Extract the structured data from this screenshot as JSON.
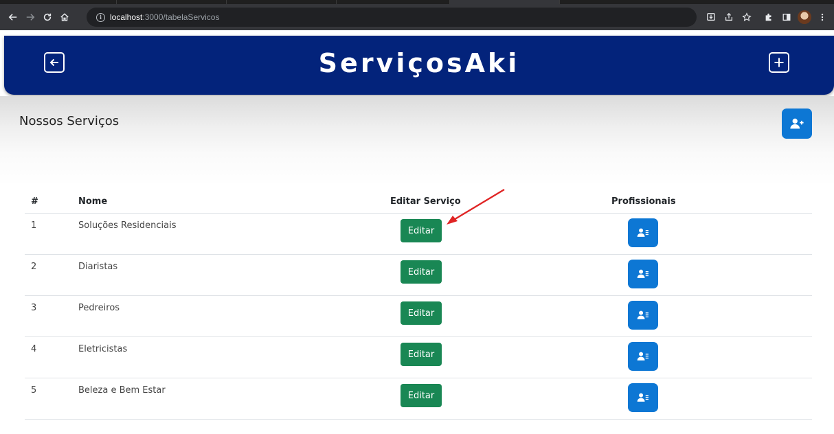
{
  "browser": {
    "url_host": "localhost",
    "url_path": ":3000/tabelaServicos",
    "info_glyph": "i"
  },
  "header": {
    "brand": "ServiçosAki"
  },
  "section": {
    "title": "Nossos Serviços"
  },
  "table": {
    "headers": {
      "num": "#",
      "name": "Nome",
      "edit": "Editar Serviço",
      "professionals": "Profissionais"
    },
    "rows": [
      {
        "num": "1",
        "name": "Soluções Residenciais",
        "edit_label": "Editar"
      },
      {
        "num": "2",
        "name": "Diaristas",
        "edit_label": "Editar"
      },
      {
        "num": "3",
        "name": "Pedreiros",
        "edit_label": "Editar"
      },
      {
        "num": "4",
        "name": "Eletricistas",
        "edit_label": "Editar"
      },
      {
        "num": "5",
        "name": "Beleza e Bem Estar",
        "edit_label": "Editar"
      }
    ]
  },
  "colors": {
    "header_bg": "#03237b",
    "primary_blue": "#0d77d4",
    "success_green": "#198754",
    "annotation_red": "#e02424"
  },
  "icons": {
    "back": "arrow-left-square-icon",
    "add": "plus-square-icon",
    "add_user": "user-plus-icon",
    "professionals": "user-list-icon"
  }
}
